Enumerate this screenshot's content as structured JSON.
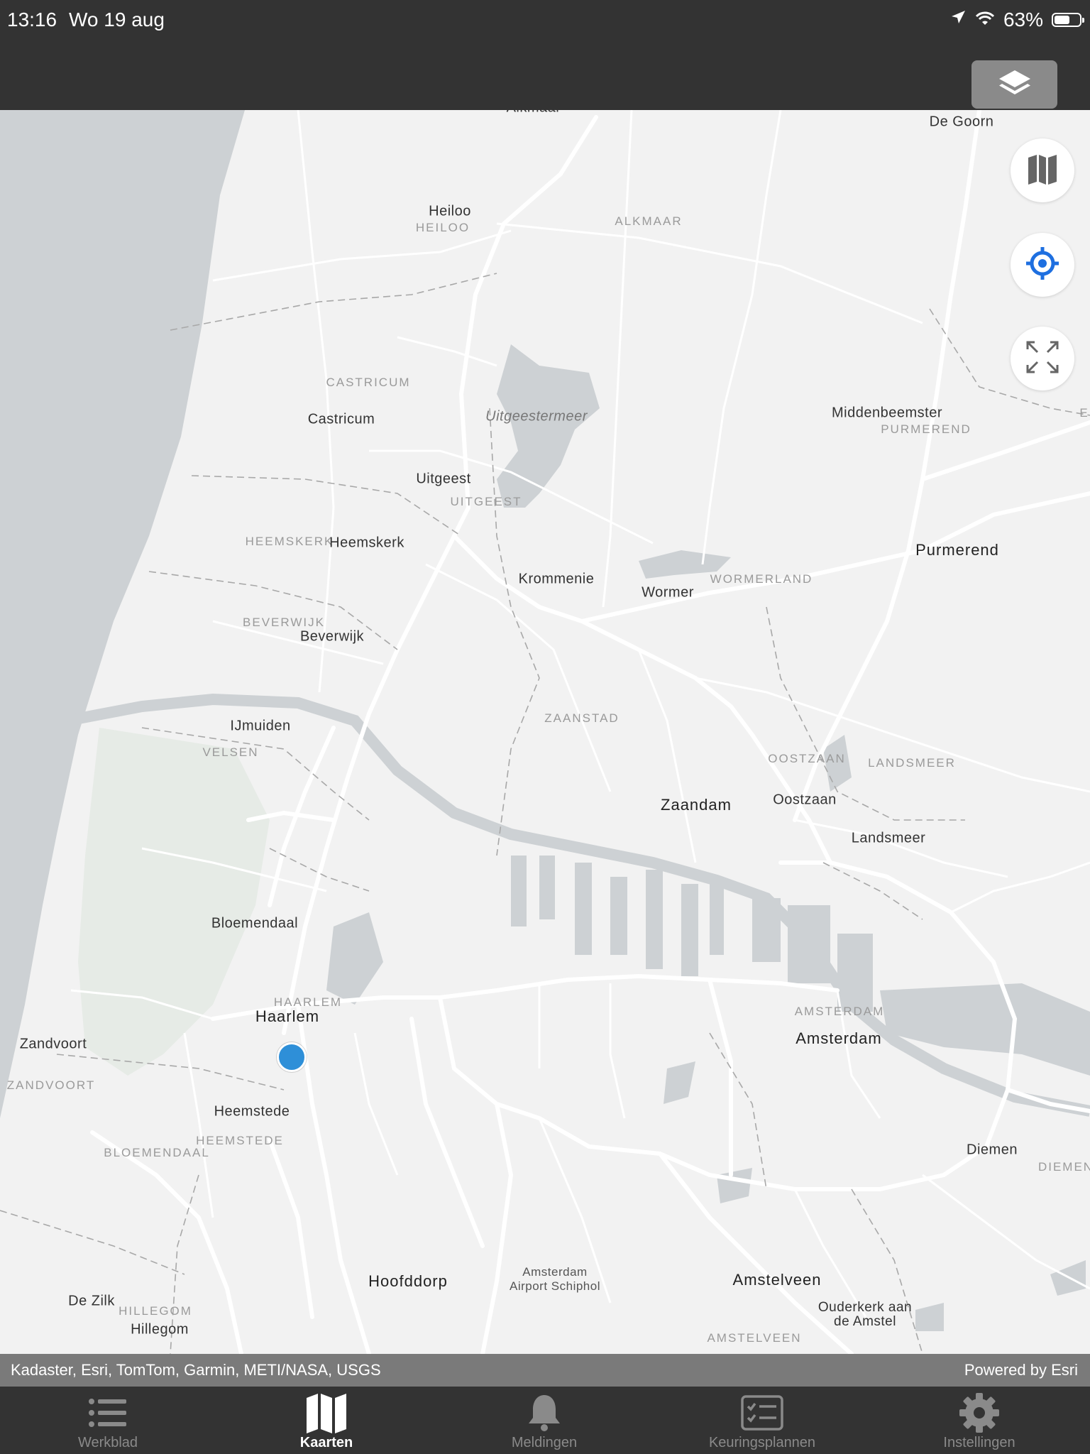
{
  "status_bar": {
    "time": "13:16",
    "date": "Wo 19 aug",
    "battery": "63%",
    "battery_level": 0.63,
    "icons": [
      "location-arrow-icon",
      "wifi-icon",
      "battery-icon"
    ]
  },
  "toolbar": {
    "layers_icon": "layers-icon"
  },
  "map_controls": {
    "basemap_icon": "map-icon",
    "locate_icon": "crosshair-icon",
    "fullscreen_icon": "expand-icon",
    "locate_color": "#1e6fe0"
  },
  "map": {
    "colors": {
      "land": "#f2f2f2",
      "water": "#cfd3d6",
      "sea": "#cdd1d4",
      "road": "#ffffff",
      "park": "#e6ebe6"
    },
    "labels": {
      "alkmaar_city": "Alkmaar",
      "de_goorn": "De Goorn",
      "heiloo": "Heiloo",
      "heiloo_muni": "HEILOO",
      "alkmaar_muni": "ALKMAAR",
      "castricum_muni": "CASTRICUM",
      "castricum": "Castricum",
      "uitgeestermeer": "Uitgeestermeer",
      "middenbeemster": "Middenbeemster",
      "purmerend_muni": "PURMEREND",
      "uitgeest": "Uitgeest",
      "uitgeest_muni": "UITGEEST",
      "heemskerk_muni": "HEEMSKERK",
      "heemskerk": "Heemskerk",
      "purmerend": "Purmerend",
      "krommenie": "Krommenie",
      "wormer": "Wormer",
      "wormerland_muni": "WORMERLAND",
      "beverwijk_muni": "BEVERWIJK",
      "beverwijk": "Beverwijk",
      "ijmuiden": "IJmuiden",
      "zaanstad_muni": "ZAANSTAD",
      "velsen_muni": "VELSEN",
      "oostzaan_muni": "OOSTZAAN",
      "landsmeer_muni": "LANDSMEER",
      "zaandam": "Zaandam",
      "oostzaan": "Oostzaan",
      "landsmeer": "Landsmeer",
      "bloemendaal": "Bloemendaal",
      "haarlem_muni": "HAARLEM",
      "haarlem": "Haarlem",
      "amsterdam_muni": "AMSTERDAM",
      "amsterdam": "Amsterdam",
      "zandvoort": "Zandvoort",
      "zandvoort_muni": "ZANDVOORT",
      "heemstede": "Heemstede",
      "heemstede_muni": "HEEMSTEDE",
      "bloemendaal_muni": "BLOEMENDAAL",
      "diemen": "Diemen",
      "diemen_muni": "DIEMEN",
      "hoofddorp": "Hoofddorp",
      "schiphol": "Amsterdam Airport Schiphol",
      "amstelveen": "Amstelveen",
      "ouderkerk": "Ouderkerk aan de Amstel",
      "de_zilk": "De Zilk",
      "hillegom_muni": "HILLEGOM",
      "hillegom": "Hillegom",
      "amstelveen_muni": "AMSTELVEEN",
      "e_edge": "E"
    }
  },
  "attribution": {
    "sources": "Kadaster, Esri, TomTom, Garmin, METI/NASA, USGS",
    "powered_by": "Powered by Esri"
  },
  "tabs": [
    {
      "label": "Werkblad",
      "icon": "list-icon",
      "active": false
    },
    {
      "label": "Kaarten",
      "icon": "map-icon",
      "active": true
    },
    {
      "label": "Meldingen",
      "icon": "bell-icon",
      "active": false
    },
    {
      "label": "Keuringsplannen",
      "icon": "checklist-icon",
      "active": false
    },
    {
      "label": "Instellingen",
      "icon": "gear-icon",
      "active": false
    }
  ]
}
